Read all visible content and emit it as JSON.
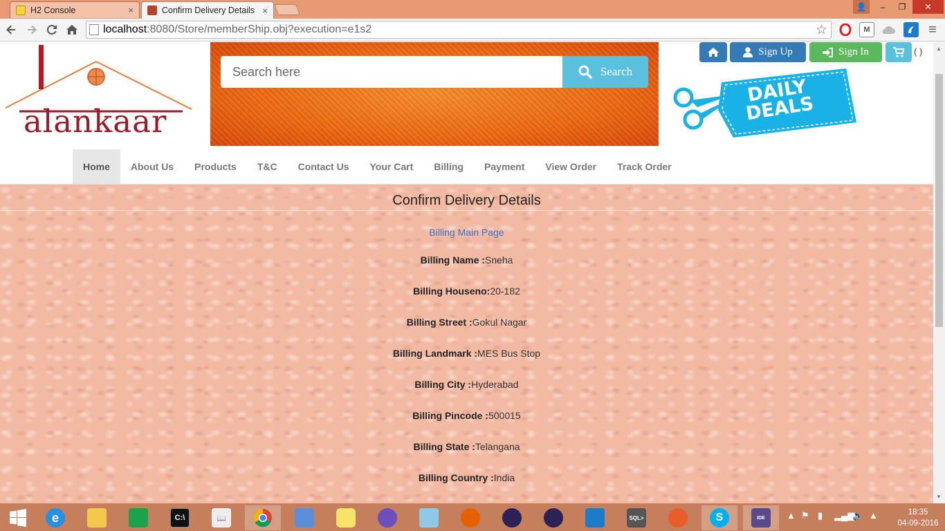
{
  "browser": {
    "tabs": [
      {
        "title": "H2 Console",
        "close": "×"
      },
      {
        "title": "Confirm Delivery Details",
        "close": "×"
      }
    ],
    "address": {
      "host": "localhost",
      "path": ":8080/Store/memberShip.obj?execution=e1s2"
    },
    "window_buttons": {
      "user": "👤",
      "minimize": "–",
      "maximize": "❐",
      "close": "✕"
    },
    "menu": "≡"
  },
  "site": {
    "logo_text": "alankaar",
    "search": {
      "placeholder": "Search here",
      "button_label": "Search"
    },
    "top_buttons": {
      "signup": "Sign Up",
      "signin": "Sign In",
      "cart_count": "( )"
    },
    "deals": {
      "line1": "DAILY",
      "line2": "DEALS"
    },
    "nav": [
      "Home",
      "About Us",
      "Products",
      "T&C",
      "Contact Us",
      "Your Cart",
      "Billing",
      "Payment",
      "View Order",
      "Track Order"
    ]
  },
  "main": {
    "title": "Confirm Delivery Details",
    "billing_link": "Billing Main Page",
    "fields": [
      {
        "label": "Billing Name :",
        "value": "Sneha"
      },
      {
        "label": "Billing Houseno:",
        "value": "20-182"
      },
      {
        "label": "Billing Street :",
        "value": "Gokul Nagar"
      },
      {
        "label": "Billing Landmark :",
        "value": "MES Bus Stop"
      },
      {
        "label": "Billing City :",
        "value": "Hyderabad"
      },
      {
        "label": "Billing Pincode :",
        "value": "500015"
      },
      {
        "label": "Billing State :",
        "value": "Telangana"
      },
      {
        "label": "Billing Country :",
        "value": "India"
      }
    ]
  },
  "taskbar": {
    "clock": {
      "time": "18:35",
      "date": "04-09-2016"
    }
  }
}
